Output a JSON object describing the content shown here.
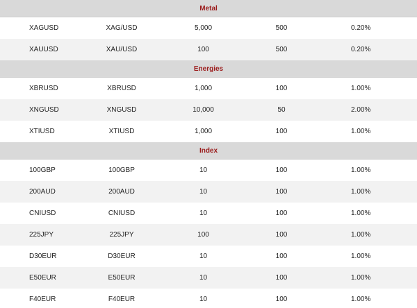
{
  "sections": [
    {
      "title": "Metal",
      "rows": [
        {
          "symbol": "XAGUSD",
          "name": "XAG/USD",
          "contract": "5,000",
          "leverage": "500",
          "margin": "0.20%"
        },
        {
          "symbol": "XAUUSD",
          "name": "XAU/USD",
          "contract": "100",
          "leverage": "500",
          "margin": "0.20%"
        }
      ]
    },
    {
      "title": "Energies",
      "rows": [
        {
          "symbol": "XBRUSD",
          "name": "XBRUSD",
          "contract": "1,000",
          "leverage": "100",
          "margin": "1.00%"
        },
        {
          "symbol": "XNGUSD",
          "name": "XNGUSD",
          "contract": "10,000",
          "leverage": "50",
          "margin": "2.00%"
        },
        {
          "symbol": "XTIUSD",
          "name": "XTIUSD",
          "contract": "1,000",
          "leverage": "100",
          "margin": "1.00%"
        }
      ]
    },
    {
      "title": "Index",
      "rows": [
        {
          "symbol": "100GBP",
          "name": "100GBP",
          "contract": "10",
          "leverage": "100",
          "margin": "1.00%"
        },
        {
          "symbol": "200AUD",
          "name": "200AUD",
          "contract": "10",
          "leverage": "100",
          "margin": "1.00%"
        },
        {
          "symbol": "CNIUSD",
          "name": "CNIUSD",
          "contract": "10",
          "leverage": "100",
          "margin": "1.00%"
        },
        {
          "symbol": "225JPY",
          "name": "225JPY",
          "contract": "100",
          "leverage": "100",
          "margin": "1.00%"
        },
        {
          "symbol": "D30EUR",
          "name": "D30EUR",
          "contract": "10",
          "leverage": "100",
          "margin": "1.00%"
        },
        {
          "symbol": "E50EUR",
          "name": "E50EUR",
          "contract": "10",
          "leverage": "100",
          "margin": "1.00%"
        },
        {
          "symbol": "F40EUR",
          "name": "F40EUR",
          "contract": "10",
          "leverage": "100",
          "margin": "1.00%"
        }
      ]
    }
  ],
  "colors": {
    "section_bg": "#d9d9d9",
    "section_text": "#9b1b1b",
    "row_alt_bg": "#f2f2f2"
  }
}
